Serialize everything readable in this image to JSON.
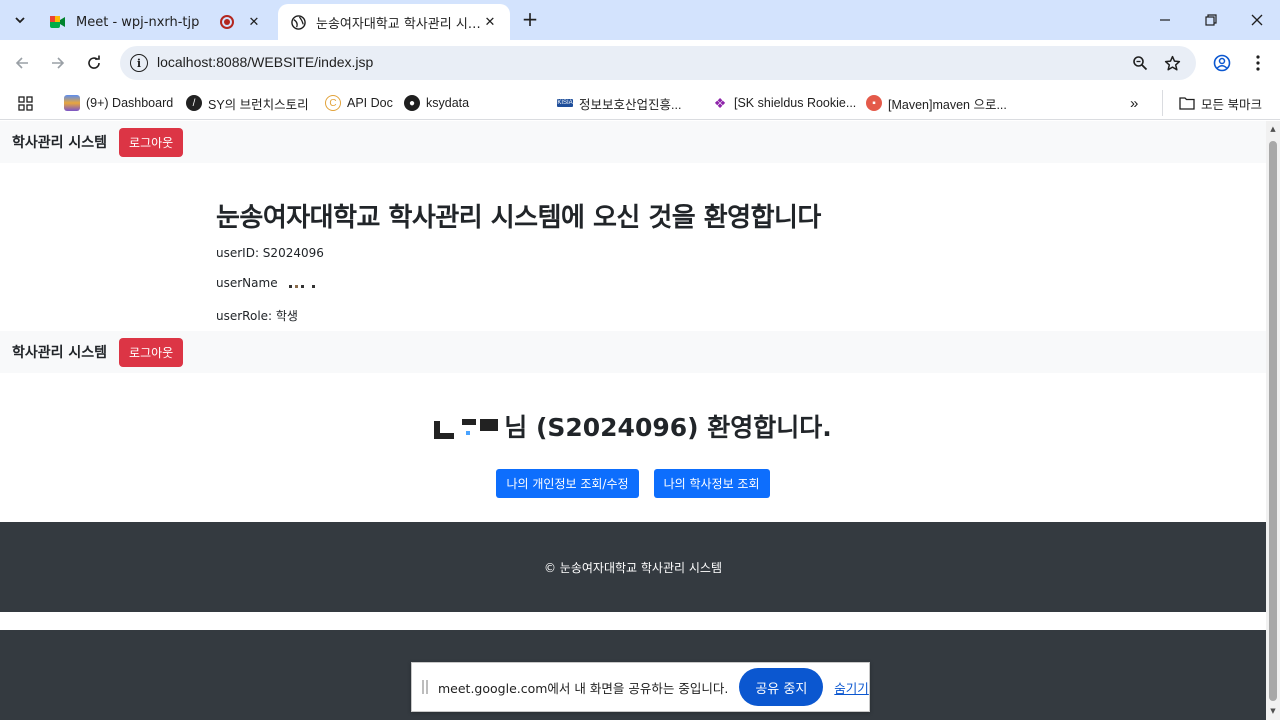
{
  "browser": {
    "tabs": [
      {
        "title": "Meet - wpj-nxrh-tjp",
        "favicon": "google-meet-icon",
        "recording": true
      },
      {
        "title": "눈송여자대학교 학사관리 시스템",
        "favicon": "globe-icon",
        "active": true
      }
    ],
    "address": "localhost:8088/WEBSITE/index.jsp",
    "bookmarks": [
      {
        "label": "(9+) Dashboard",
        "icon": "dashboard-icon"
      },
      {
        "label": "SY의 브런치스토리",
        "icon": "brunch-icon"
      },
      {
        "label": "API Doc",
        "icon": "api-doc-icon"
      },
      {
        "label": "ksydata",
        "icon": "github-icon"
      },
      {
        "label": "정보보호산업진흥...",
        "icon": "kisia-icon"
      },
      {
        "label": "[SK shieldus Rookie...",
        "icon": "paw-icon"
      },
      {
        "label": "[Maven]maven 으로...",
        "icon": "velog-icon"
      }
    ],
    "all_bookmarks": "모든 북마크",
    "colors": {
      "tabbar": "#d3e3fd",
      "omnibox": "#e9eef6"
    }
  },
  "page": {
    "brand": "학사관리 시스템",
    "logout_label": "로그아웃",
    "welcome_title": "눈송여자대학교 학사관리 시스템에 오신 것을 환영합니다",
    "user_id_line": "userID: S2024096",
    "user_name_label": "userName",
    "user_role_line": "userRole: 학생",
    "greeting": "님 (S2024096) 환영합니다.",
    "buttons": {
      "profile": "나의 개인정보 조회/수정",
      "academic": "나의 학사정보 조회"
    },
    "footer": "© 눈송여자대학교 학사관리 시스템",
    "colors": {
      "danger": "#dc3545",
      "primary": "#0d6efd",
      "footer_bg": "#343a40",
      "navbar_bg": "#f8f9fa"
    }
  },
  "share_notice": {
    "text": "meet.google.com에서 내 화면을 공유하는 중입니다.",
    "stop_label": "공유 중지",
    "hide_label": "숨기기"
  }
}
